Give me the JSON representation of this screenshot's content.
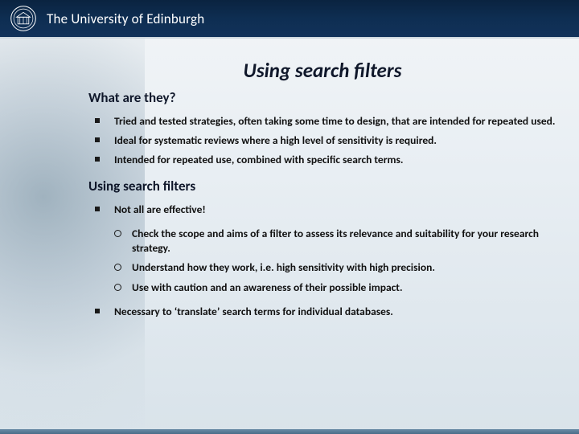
{
  "header": {
    "org_name": "The University of Edinburgh"
  },
  "slide": {
    "title": "Using search filters",
    "section1": {
      "heading": "What are they?",
      "bullets": [
        "Tried and tested strategies, often taking some time to design, that are intended for repeated used.",
        "Ideal for systematic reviews where a high level of sensitivity is required.",
        "Intended for repeated use, combined with specific search terms."
      ]
    },
    "section2": {
      "heading": "Using search filters",
      "bullets_top": [
        "Not all are effective!"
      ],
      "sub_bullets": [
        "Check the scope and aims of a filter to assess its relevance and suitability for your research strategy.",
        "Understand how they work, i.e. high sensitivity with high precision.",
        "Use with caution and an awareness of their possible impact."
      ],
      "bullets_bottom": [
        "Necessary to ‘translate’ search terms for individual databases."
      ]
    }
  }
}
